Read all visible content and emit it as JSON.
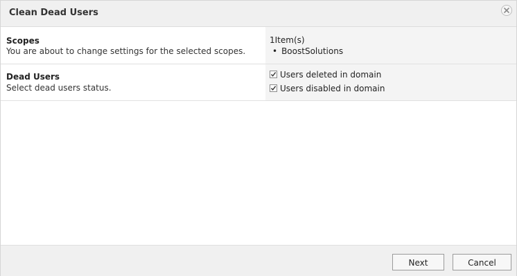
{
  "dialog": {
    "title": "Clean Dead Users",
    "close_icon": "close-icon"
  },
  "scopes": {
    "label": "Scopes",
    "description": "You are about to change settings for the selected scopes.",
    "count": "1Item(s)",
    "items": [
      "BoostSolutions"
    ]
  },
  "dead_users": {
    "label": "Dead Users",
    "description": "Select dead users status.",
    "options": [
      {
        "label": "Users deleted in domain",
        "checked": true
      },
      {
        "label": "Users disabled in domain",
        "checked": true
      }
    ]
  },
  "footer": {
    "next_label": "Next",
    "cancel_label": "Cancel"
  }
}
